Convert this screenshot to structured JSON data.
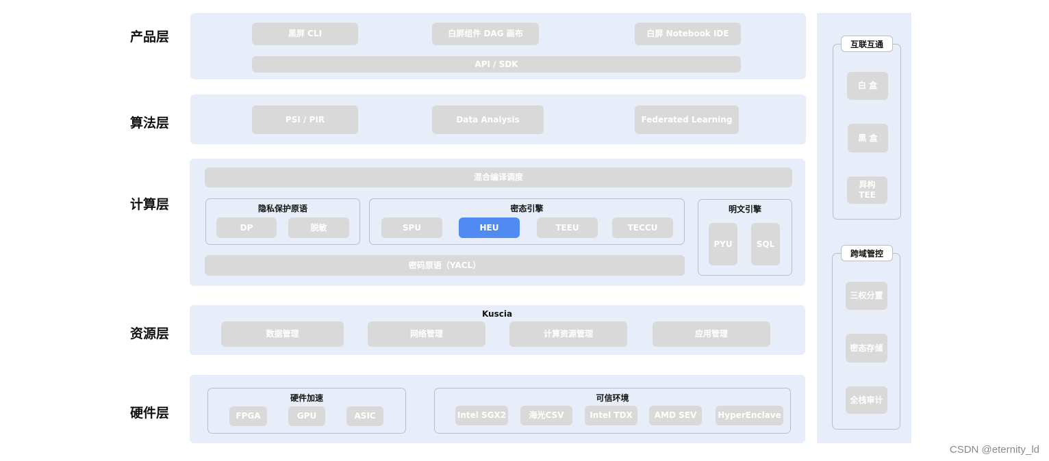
{
  "layers": {
    "product": "产品层",
    "algorithm": "算法层",
    "compute": "计算层",
    "resource": "资源层",
    "hardware": "硬件层"
  },
  "product": {
    "blackscreen_cli": "黑屏 CLI",
    "whitescreen_dag": "白屏组件 DAG 画布",
    "whitescreen_notebook": "白屏 Notebook IDE",
    "api_sdk": "API / SDK"
  },
  "algorithm": {
    "psi_pir": "PSI / PIR",
    "data_analysis": "Data Analysis",
    "federated_learning": "Federated Learning"
  },
  "compute": {
    "hybrid_compile": "混合编译调度",
    "privacy_primitives": {
      "title": "隐私保护原语",
      "dp": "DP",
      "desensitize": "脱敏"
    },
    "cipher_engines": {
      "title": "密态引擎",
      "spu": "SPU",
      "heu": "HEU",
      "teeu": "TEEU",
      "teccu": "TECCU"
    },
    "plaintext_engines": {
      "title": "明文引擎",
      "pyu": "PYU",
      "sql": "SQL"
    },
    "yacl": "密码原语（YACL）"
  },
  "resource": {
    "kuscia": "Kuscia",
    "data_mgmt": "数据管理",
    "network_mgmt": "网络管理",
    "compute_mgmt": "计算资源管理",
    "app_mgmt": "应用管理"
  },
  "hardware": {
    "acceleration": {
      "title": "硬件加速",
      "fpga": "FPGA",
      "gpu": "GPU",
      "asic": "ASIC"
    },
    "trusted_env": {
      "title": "可信环境",
      "sgx2": "Intel SGX2",
      "hygon": "海光CSV",
      "tdx": "Intel TDX",
      "amd": "AMD SEV",
      "hyperenclave": "HyperEnclave"
    }
  },
  "side": {
    "interop": {
      "title": "互联互通",
      "whitebox": "白 盒",
      "blackbox": "黑 盒",
      "hetero_tee": "异构\nTEE"
    },
    "crossdomain": {
      "title": "跨域管控",
      "separation": "三权分置",
      "cipher_storage": "密态存储",
      "audit": "全栈审计"
    }
  },
  "watermark": "CSDN @eternity_ld",
  "colors": {
    "band": "#e8eef9",
    "chip": "#d9d9d9",
    "active": "#4f8bf0"
  }
}
